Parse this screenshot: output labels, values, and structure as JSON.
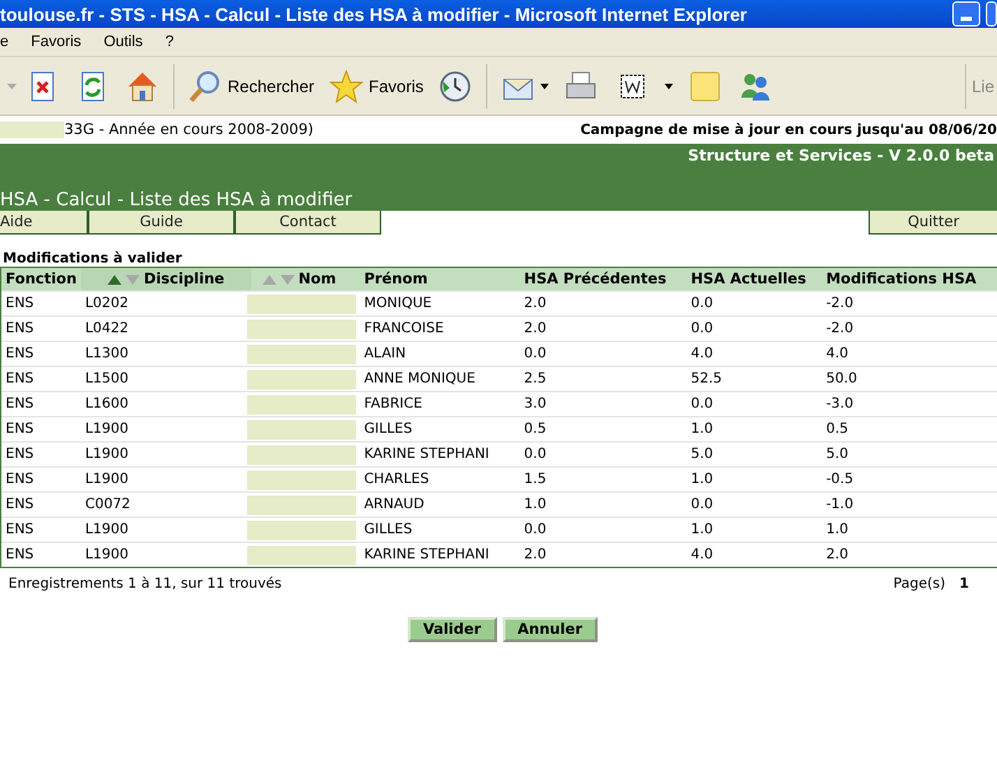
{
  "window": {
    "title": "toulouse.fr - STS - HSA - Calcul - Liste des HSA à modifier - Microsoft Internet Explorer"
  },
  "menu": [
    "e",
    "Favoris",
    "Outils",
    "?"
  ],
  "toolbar": {
    "search_label": "Rechercher",
    "favorites_label": "Favoris",
    "links_label": "Lie"
  },
  "info_bar": {
    "context": "33G - Année en cours 2008-2009)",
    "campaign": "Campagne de mise à jour en cours jusqu'au 08/06/20"
  },
  "header": {
    "app": "Structure et Services - V 2.0.0 beta",
    "page_title": "HSA - Calcul - Liste des HSA à modifier"
  },
  "nav": {
    "left": [
      "Aide",
      "Guide",
      "Contact"
    ],
    "right": [
      "Quitter"
    ]
  },
  "section_title": "Modifications à valider",
  "table": {
    "columns": [
      {
        "label": "Fonction",
        "sortable": false
      },
      {
        "label": "Discipline",
        "sortable": true,
        "sorted": true
      },
      {
        "label": "Nom",
        "sortable": true,
        "sorted": false
      },
      {
        "label": "Prénom",
        "sortable": false
      },
      {
        "label": "HSA Précédentes",
        "sortable": false
      },
      {
        "label": "HSA Actuelles",
        "sortable": false
      },
      {
        "label": "Modifications HSA",
        "sortable": false
      }
    ],
    "rows": [
      [
        "ENS",
        "L0202",
        "",
        "MONIQUE",
        "2.0",
        "0.0",
        "-2.0"
      ],
      [
        "ENS",
        "L0422",
        "",
        "FRANCOISE",
        "2.0",
        "0.0",
        "-2.0"
      ],
      [
        "ENS",
        "L1300",
        "",
        "ALAIN",
        "0.0",
        "4.0",
        "4.0"
      ],
      [
        "ENS",
        "L1500",
        "",
        "ANNE MONIQUE",
        "2.5",
        "52.5",
        "50.0"
      ],
      [
        "ENS",
        "L1600",
        "",
        "FABRICE",
        "3.0",
        "0.0",
        "-3.0"
      ],
      [
        "ENS",
        "L1900",
        "",
        "GILLES",
        "0.5",
        "1.0",
        "0.5"
      ],
      [
        "ENS",
        "L1900",
        "",
        "KARINE STEPHANI",
        "0.0",
        "5.0",
        "5.0"
      ],
      [
        "ENS",
        "L1900",
        "",
        "CHARLES",
        "1.5",
        "1.0",
        "-0.5"
      ],
      [
        "ENS",
        "C0072",
        "",
        "ARNAUD",
        "1.0",
        "0.0",
        "-1.0"
      ],
      [
        "ENS",
        "L1900",
        "",
        "GILLES",
        "0.0",
        "1.0",
        "1.0"
      ],
      [
        "ENS",
        "L1900",
        "",
        "KARINE STEPHANI",
        "2.0",
        "4.0",
        "2.0"
      ]
    ]
  },
  "footer": {
    "records": "Enregistrements 1 à 11, sur 11 trouvés",
    "pages_label": "Page(s)",
    "current_page": "1"
  },
  "buttons": [
    "Valider",
    "Annuler"
  ]
}
